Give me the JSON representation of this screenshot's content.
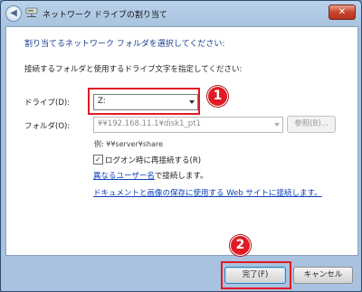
{
  "window": {
    "title": "ネットワーク ドライブの割り当て",
    "close_glyph": "✕",
    "back_glyph": "◀"
  },
  "heading": "割り当てるネットワーク フォルダを選択してください:",
  "instruction": "接続するフォルダと使用するドライブ文字を指定してください:",
  "drive": {
    "label": "ドライブ(D):",
    "value": "Z:"
  },
  "folder": {
    "label": "フォルダ(O):",
    "value": "¥¥192.168.11.1¥disk1_pt1",
    "browse_label": "参照(B)..."
  },
  "example": "例: ¥¥server¥share",
  "reconnect": {
    "label": "ログオン時に再接続する(R)",
    "checked_glyph": "✓"
  },
  "other_user": {
    "link": "異なるユーザー名",
    "suffix": "で接続します。"
  },
  "web_link": "ドキュメントと画像の保存に使用する Web サイトに接続します。",
  "buttons": {
    "finish": "完了(F)",
    "cancel": "キャンセル"
  },
  "badges": {
    "one": "1",
    "two": "2"
  },
  "colors": {
    "highlight": "#e01b24",
    "link": "#0d41b8",
    "heading": "#1b3d8c"
  }
}
